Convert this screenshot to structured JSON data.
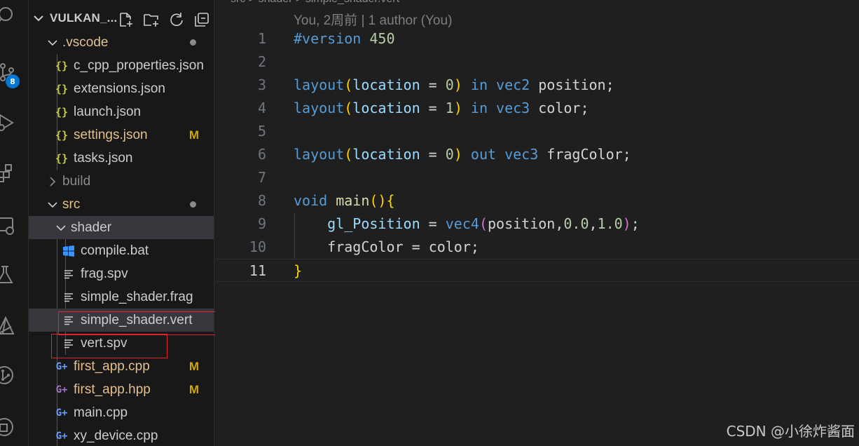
{
  "explorer": {
    "title": "VULKAN_...",
    "tools": [
      "new-file-icon",
      "new-folder-icon",
      "refresh-icon",
      "collapse-all-icon"
    ],
    "items": [
      {
        "label": ".vscode",
        "type": "folder",
        "open": true,
        "depth": 1,
        "status": "dot"
      },
      {
        "label": "c_cpp_properties.json",
        "type": "json",
        "depth": 2
      },
      {
        "label": "extensions.json",
        "type": "json",
        "depth": 2
      },
      {
        "label": "launch.json",
        "type": "json",
        "depth": 2
      },
      {
        "label": "settings.json",
        "type": "json",
        "depth": 2,
        "status": "M"
      },
      {
        "label": "tasks.json",
        "type": "json",
        "depth": 2
      },
      {
        "label": "build",
        "type": "folder",
        "open": false,
        "depth": 1
      },
      {
        "label": "src",
        "type": "folder",
        "open": true,
        "depth": 1,
        "status": "dot"
      },
      {
        "label": "shader",
        "type": "folder",
        "open": true,
        "depth": 2,
        "selected": true
      },
      {
        "label": "compile.bat",
        "type": "bat",
        "depth": 3
      },
      {
        "label": "frag.spv",
        "type": "text",
        "depth": 3
      },
      {
        "label": "simple_shader.frag",
        "type": "text",
        "depth": 3
      },
      {
        "label": "simple_shader.vert",
        "type": "text",
        "depth": 3,
        "active": true
      },
      {
        "label": "vert.spv",
        "type": "text",
        "depth": 3
      },
      {
        "label": "first_app.cpp",
        "type": "cpp",
        "depth": 2,
        "status": "M"
      },
      {
        "label": "first_app.hpp",
        "type": "hpp",
        "depth": 2,
        "status": "M"
      },
      {
        "label": "main.cpp",
        "type": "cpp",
        "depth": 2
      },
      {
        "label": "xy_device.cpp",
        "type": "cpp",
        "depth": 2
      }
    ]
  },
  "activity_bar": {
    "icons": [
      "search-icon",
      "source-control-icon",
      "run-debug-icon",
      "extensions-icon",
      "remote-explorer-icon",
      "testing-icon",
      "cmake-icon",
      "git-graph-icon",
      "docker-icon"
    ],
    "source_control_badge": "8"
  },
  "editor": {
    "breadcrumb": "src > shader > simple_shader.vert",
    "blame": "You, 2周前 | 1 author (You)",
    "current_line": 11,
    "lines": [
      {
        "n": "1",
        "text": "#version 450"
      },
      {
        "n": "2",
        "text": ""
      },
      {
        "n": "3",
        "text": "layout(location = 0) in vec2 position;"
      },
      {
        "n": "4",
        "text": "layout(location = 1) in vec3 color;"
      },
      {
        "n": "5",
        "text": ""
      },
      {
        "n": "6",
        "text": "layout(location = 0) out vec3 fragColor;"
      },
      {
        "n": "7",
        "text": ""
      },
      {
        "n": "8",
        "text": "void main(){"
      },
      {
        "n": "9",
        "text": "    gl_Position = vec4(position,0.0,1.0);"
      },
      {
        "n": "10",
        "text": "    fragColor = color;"
      },
      {
        "n": "11",
        "text": "}"
      }
    ]
  },
  "watermark": "CSDN @小徐炸酱面",
  "colors": {
    "accent": "#0078d4",
    "modified": "#e2c08d",
    "status_m": "#cca700",
    "highlight_box": "#e0262c"
  }
}
